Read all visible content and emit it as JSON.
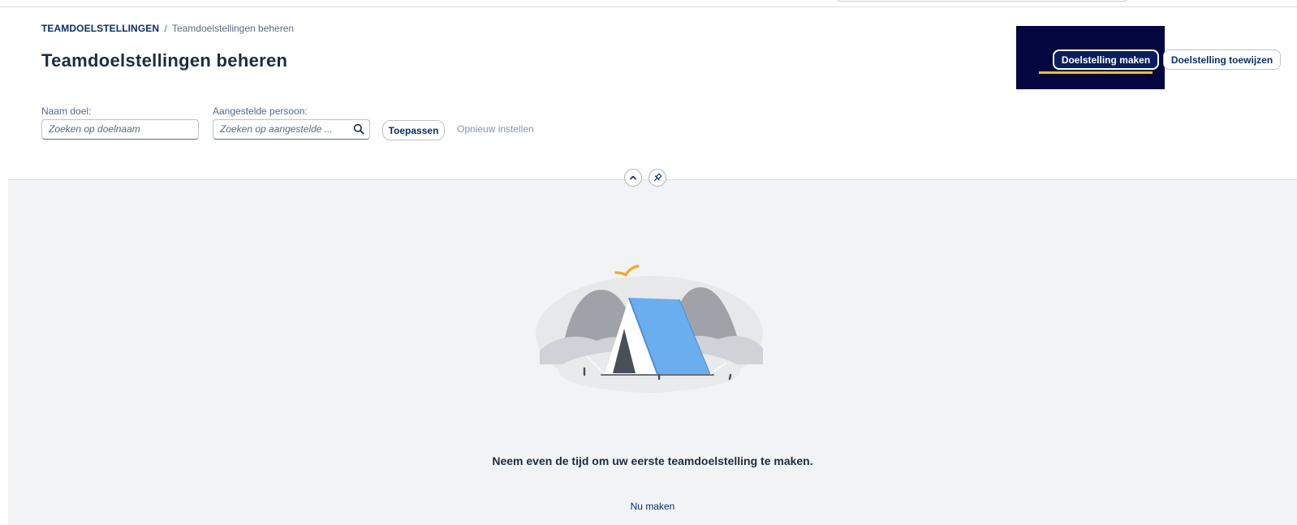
{
  "breadcrumb": {
    "parent": "TEAMDOELSTELLINGEN",
    "separator": "/",
    "current": "Teamdoelstellingen beheren"
  },
  "header": {
    "title": "Teamdoelstellingen beheren",
    "actions": {
      "create_label": "Doelstelling maken",
      "assign_label": "Doelstelling toewijzen"
    }
  },
  "filters": {
    "goal_name": {
      "label": "Naam doel:",
      "placeholder": "Zoeken op doelnaam",
      "value": ""
    },
    "assignee": {
      "label": "Aangestelde persoon:",
      "placeholder": "Zoeken op aangestelde ...",
      "value": ""
    },
    "apply_label": "Toepassen",
    "reset_label": "Opnieuw instellen"
  },
  "header_controls": {
    "collapse_icon": "chevron-up-icon",
    "pin_icon": "pin-icon"
  },
  "empty_state": {
    "illustration": "tent-camping-illustration",
    "message": "Neem even de tijd om uw eerste teamdoelstelling te maken.",
    "action_label": "Nu maken"
  },
  "colors": {
    "primary": "#0a1f5c",
    "link": "#0a2e6e",
    "focus_frame": "#03063f",
    "focus_accent": "#f5c400",
    "content_background": "#f2f3f4",
    "tent": "#6aaef0",
    "bird": "#f5a623"
  }
}
